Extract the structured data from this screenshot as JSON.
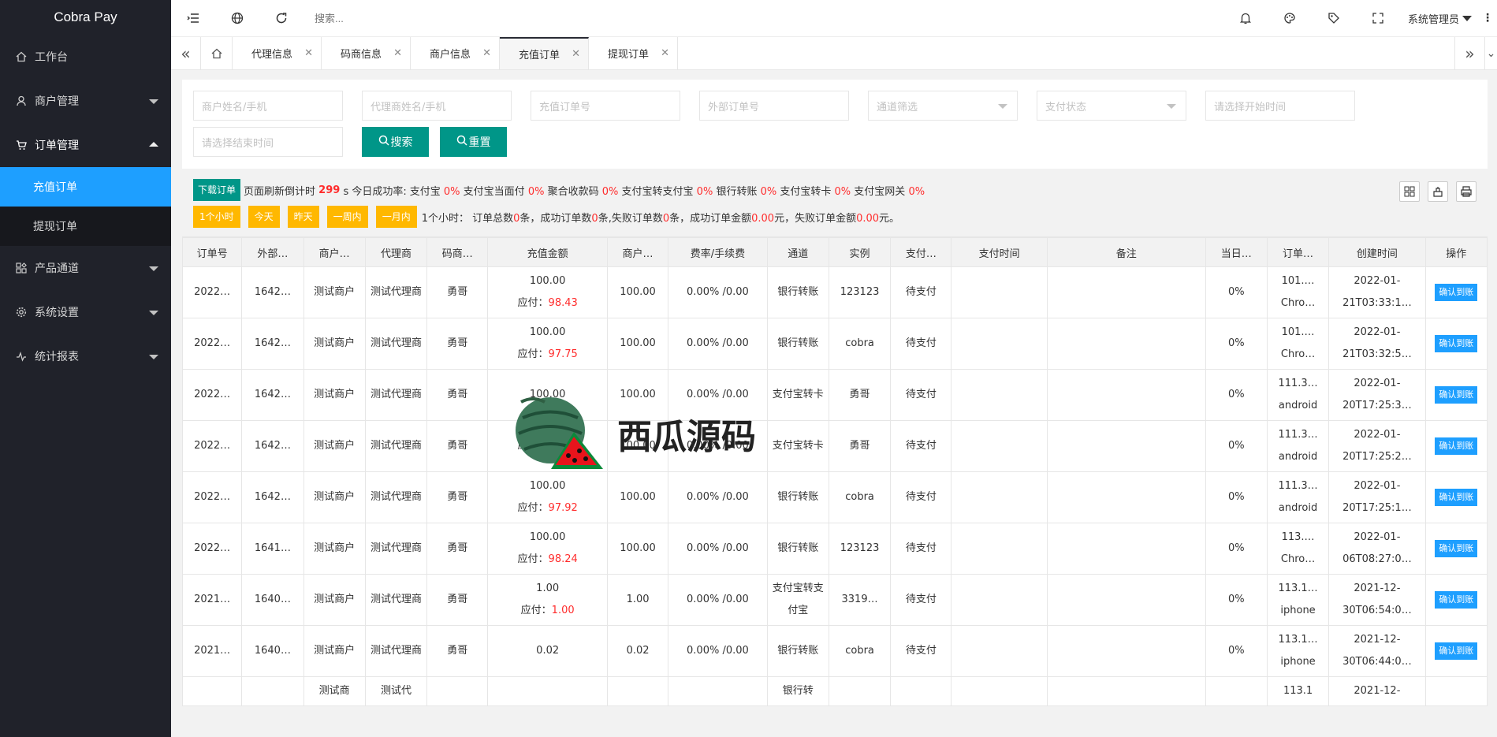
{
  "brand": "Cobra Pay",
  "sidebar": {
    "items": [
      {
        "label": "工作台",
        "icon": "home-icon"
      },
      {
        "label": "商户管理",
        "icon": "user-icon"
      },
      {
        "label": "订单管理",
        "icon": "cart-icon"
      },
      {
        "label": "充值订单"
      },
      {
        "label": "提现订单"
      },
      {
        "label": "产品通道",
        "icon": "apps-icon"
      },
      {
        "label": "系统设置",
        "icon": "gear-icon"
      },
      {
        "label": "统计报表",
        "icon": "chart-icon"
      }
    ]
  },
  "topbar": {
    "search_placeholder": "搜索...",
    "user": "系统管理员"
  },
  "tabs": [
    {
      "label": "代理信息"
    },
    {
      "label": "码商信息"
    },
    {
      "label": "商户信息"
    },
    {
      "label": "充值订单"
    },
    {
      "label": "提现订单"
    }
  ],
  "filters": {
    "merchant": "商户姓名/手机",
    "agent": "代理商姓名/手机",
    "order_no": "充值订单号",
    "external_no": "外部订单号",
    "channel": "通道筛选",
    "status": "支付状态",
    "start_time": "请选择开始时间",
    "end_time": "请选择结束时间",
    "search_btn": "搜索",
    "reset_btn": "重置"
  },
  "toolbar": {
    "download": "下载订单",
    "refresh_label": "页面刷新倒计时",
    "countdown": "299",
    "rate_label": "s 今日成功率:",
    "rates": [
      {
        "name": "支付宝",
        "val": "0%"
      },
      {
        "name": "支付宝当面付",
        "val": "0%"
      },
      {
        "name": "聚合收款码",
        "val": "0%"
      },
      {
        "name": "支付宝转支付宝",
        "val": "0%"
      },
      {
        "name": "银行转账",
        "val": "0%"
      },
      {
        "name": "支付宝转卡",
        "val": "0%"
      },
      {
        "name": "支付宝网关",
        "val": "0%"
      }
    ],
    "ranges": [
      "1个小时",
      "今天",
      "昨天",
      "一周内",
      "一月内"
    ],
    "summary": {
      "p1": "1个小时：  订单总数",
      "n1": "0",
      "p2": "条，成功订单数",
      "n2": "0",
      "p3": "条,失败订单数",
      "n3": "0",
      "p4": "条，成功订单金额",
      "n4": "0.00",
      "p5": "元，失败订单金额",
      "n5": "0.00",
      "p6": "元。"
    }
  },
  "table": {
    "headers": [
      "订单号",
      "外部…",
      "商户…",
      "代理商",
      "码商…",
      "充值金额",
      "商户…",
      "费率/手续费",
      "通道",
      "实例",
      "支付…",
      "支付时间",
      "备注",
      "当日…",
      "订单…",
      "创建时间",
      "操作"
    ],
    "pay_label": "应付：",
    "action": "确认到账",
    "rows": [
      {
        "order": "2022…",
        "ext": "1642…",
        "merchant": "测试商户",
        "agent": "测试代理商",
        "coder": "勇哥",
        "amount": "100.00",
        "payable": "98.43",
        "merchant_amt": "100.00",
        "fee": "0.00% /0.00",
        "channel": "银行转账",
        "instance": "123123",
        "status": "待支付",
        "pay_time": "",
        "remark": "",
        "daily": "0%",
        "ip": "101.…",
        "device": "Chro…",
        "created": "2022-01-21T03:33:1…"
      },
      {
        "order": "2022…",
        "ext": "1642…",
        "merchant": "测试商户",
        "agent": "测试代理商",
        "coder": "勇哥",
        "amount": "100.00",
        "payable": "97.75",
        "merchant_amt": "100.00",
        "fee": "0.00% /0.00",
        "channel": "银行转账",
        "instance": "cobra",
        "status": "待支付",
        "pay_time": "",
        "remark": "",
        "daily": "0%",
        "ip": "101.…",
        "device": "Chro…",
        "created": "2022-01-21T03:32:5…"
      },
      {
        "order": "2022…",
        "ext": "1642…",
        "merchant": "测试商户",
        "agent": "测试代理商",
        "coder": "勇哥",
        "amount": "100.00",
        "payable": "",
        "merchant_amt": "100.00",
        "fee": "0.00% /0.00",
        "channel": "支付宝转卡",
        "instance": "勇哥",
        "status": "待支付",
        "pay_time": "",
        "remark": "",
        "daily": "0%",
        "ip": "111.3…",
        "device": "android",
        "created": "2022-01-20T17:25:3…"
      },
      {
        "order": "2022…",
        "ext": "1642…",
        "merchant": "测试商户",
        "agent": "测试代理商",
        "coder": "勇哥",
        "amount": "",
        "payable": "97.63",
        "merchant_amt": "100.00",
        "fee": "0.00% /0.00",
        "channel": "支付宝转卡",
        "instance": "勇哥",
        "status": "待支付",
        "pay_time": "",
        "remark": "",
        "daily": "0%",
        "ip": "111.3…",
        "device": "android",
        "created": "2022-01-20T17:25:2…"
      },
      {
        "order": "2022…",
        "ext": "1642…",
        "merchant": "测试商户",
        "agent": "测试代理商",
        "coder": "勇哥",
        "amount": "100.00",
        "payable": "97.92",
        "merchant_amt": "100.00",
        "fee": "0.00% /0.00",
        "channel": "银行转账",
        "instance": "cobra",
        "status": "待支付",
        "pay_time": "",
        "remark": "",
        "daily": "0%",
        "ip": "111.3…",
        "device": "android",
        "created": "2022-01-20T17:25:1…"
      },
      {
        "order": "2022…",
        "ext": "1641…",
        "merchant": "测试商户",
        "agent": "测试代理商",
        "coder": "勇哥",
        "amount": "100.00",
        "payable": "98.24",
        "merchant_amt": "100.00",
        "fee": "0.00% /0.00",
        "channel": "银行转账",
        "instance": "123123",
        "status": "待支付",
        "pay_time": "",
        "remark": "",
        "daily": "0%",
        "ip": "113.…",
        "device": "Chro…",
        "created": "2022-01-06T08:27:0…"
      },
      {
        "order": "2021…",
        "ext": "1640…",
        "merchant": "测试商户",
        "agent": "测试代理商",
        "coder": "勇哥",
        "amount": "1.00",
        "payable": "1.00",
        "merchant_amt": "1.00",
        "fee": "0.00% /0.00",
        "channel": "支付宝转支付宝",
        "instance": "3319…",
        "status": "待支付",
        "pay_time": "",
        "remark": "",
        "daily": "0%",
        "ip": "113.1…",
        "device": "iphone",
        "created": "2021-12-30T06:54:0…"
      },
      {
        "order": "2021…",
        "ext": "1640…",
        "merchant": "测试商户",
        "agent": "测试代理商",
        "coder": "勇哥",
        "amount": "0.02",
        "payable": "",
        "merchant_amt": "0.02",
        "fee": "0.00% /0.00",
        "channel": "银行转账",
        "instance": "cobra",
        "status": "待支付",
        "pay_time": "",
        "remark": "",
        "daily": "0%",
        "ip": "113.1…",
        "device": "iphone",
        "created": "2021-12-30T06:44:0…"
      },
      {
        "order": "",
        "ext": "",
        "merchant": "测试商",
        "agent": "测试代",
        "coder": "",
        "amount": "",
        "payable": "",
        "merchant_amt": "",
        "fee": "",
        "channel": "银行转",
        "instance": "",
        "status": "",
        "pay_time": "",
        "remark": "",
        "daily": "",
        "ip": "113.1",
        "device": "",
        "created": "2021-12-"
      }
    ]
  },
  "watermark": "西瓜源码"
}
